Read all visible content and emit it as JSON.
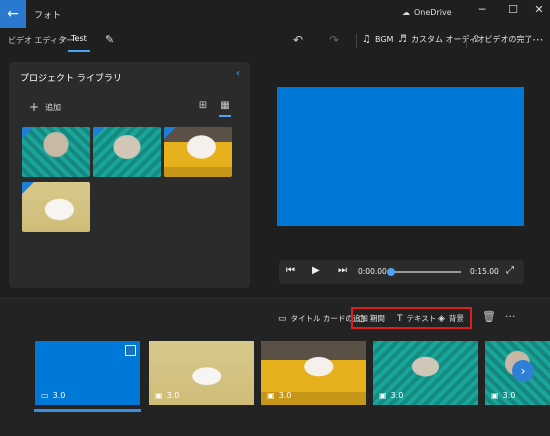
{
  "app": {
    "title": "フォト",
    "brand": "OneDrive"
  },
  "window_controls": {
    "minimize": "─",
    "maximize": "☐",
    "close": "✕"
  },
  "toolbar": {
    "breadcrumb_parent": "ビデオ エディター",
    "separator": ">",
    "project_name": "Test",
    "bgm_label": "BGM",
    "custom_audio_label": "カスタム オーディオ",
    "finish_video_label": "ビデオの完了"
  },
  "library": {
    "title": "プロジェクト ライブラリ",
    "add_label": "追加"
  },
  "player": {
    "current_time": "0:00.00",
    "total_time": "0:15.00"
  },
  "storyboard": {
    "title_card_label": "タイトル カードの追加",
    "duration_label": "期間",
    "text_label": "テキスト",
    "background_label": "背景"
  },
  "clips": [
    {
      "duration": "3.0",
      "kind": "title-card"
    },
    {
      "duration": "3.0",
      "kind": "image"
    },
    {
      "duration": "3.0",
      "kind": "image"
    },
    {
      "duration": "3.0",
      "kind": "image"
    },
    {
      "duration": "3.0",
      "kind": "image"
    }
  ],
  "colors": {
    "accent": "#0078d7",
    "highlight": "#e21b1b",
    "background": "#1f1f1f"
  }
}
